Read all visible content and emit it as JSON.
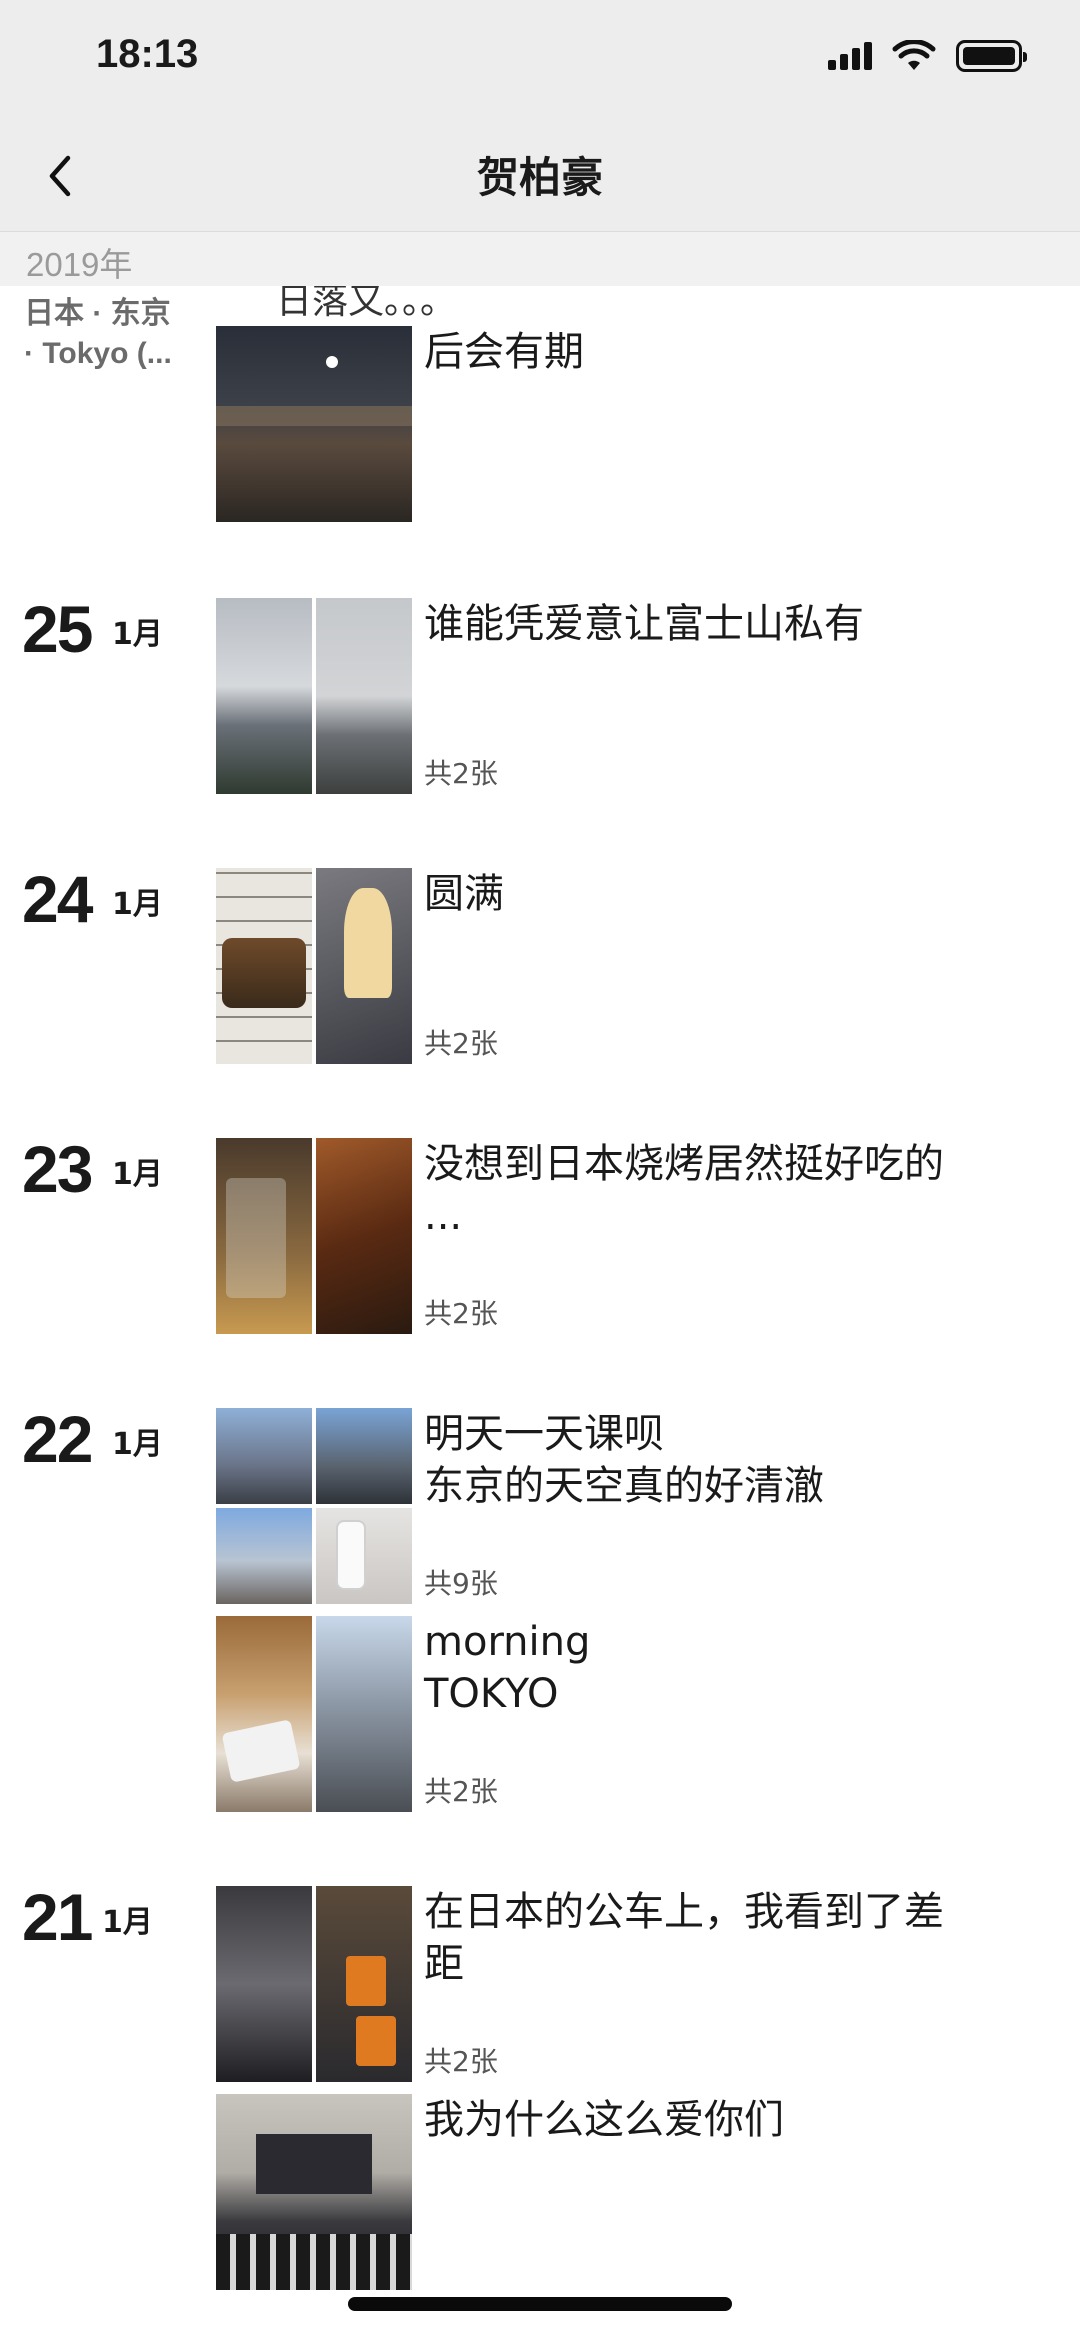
{
  "status_bar": {
    "time": "18:13"
  },
  "nav": {
    "title": "贺柏豪"
  },
  "timeline": {
    "year": "2019年",
    "partial_caption": "日落又。。。",
    "location": "日本 · 东京\n· Tokyo (..."
  },
  "entries": [
    {
      "day": "",
      "month": "",
      "posts": [
        {
          "caption": "后会有期",
          "count": ""
        }
      ]
    },
    {
      "day": "25",
      "month": "1月",
      "posts": [
        {
          "caption": "谁能凭爱意让富士山私有",
          "count": "共2张"
        }
      ]
    },
    {
      "day": "24",
      "month": "1月",
      "posts": [
        {
          "caption": "圆满",
          "count": "共2张"
        }
      ]
    },
    {
      "day": "23",
      "month": "1月",
      "posts": [
        {
          "caption": "没想到日本烧烤居然挺好吃的\n...",
          "count": "共2张"
        }
      ]
    },
    {
      "day": "22",
      "month": "1月",
      "posts": [
        {
          "caption": "明天一天课呗\n东京的天空真的好清澈",
          "count": "共9张"
        },
        {
          "caption": "morning\nTOKYO",
          "count": "共2张"
        }
      ]
    },
    {
      "day": "21",
      "month": "1月",
      "posts": [
        {
          "caption": "在日本的公车上，我看到了差\n距",
          "count": "共2张"
        },
        {
          "caption": "我为什么这么爱你们",
          "count": ""
        }
      ]
    }
  ]
}
